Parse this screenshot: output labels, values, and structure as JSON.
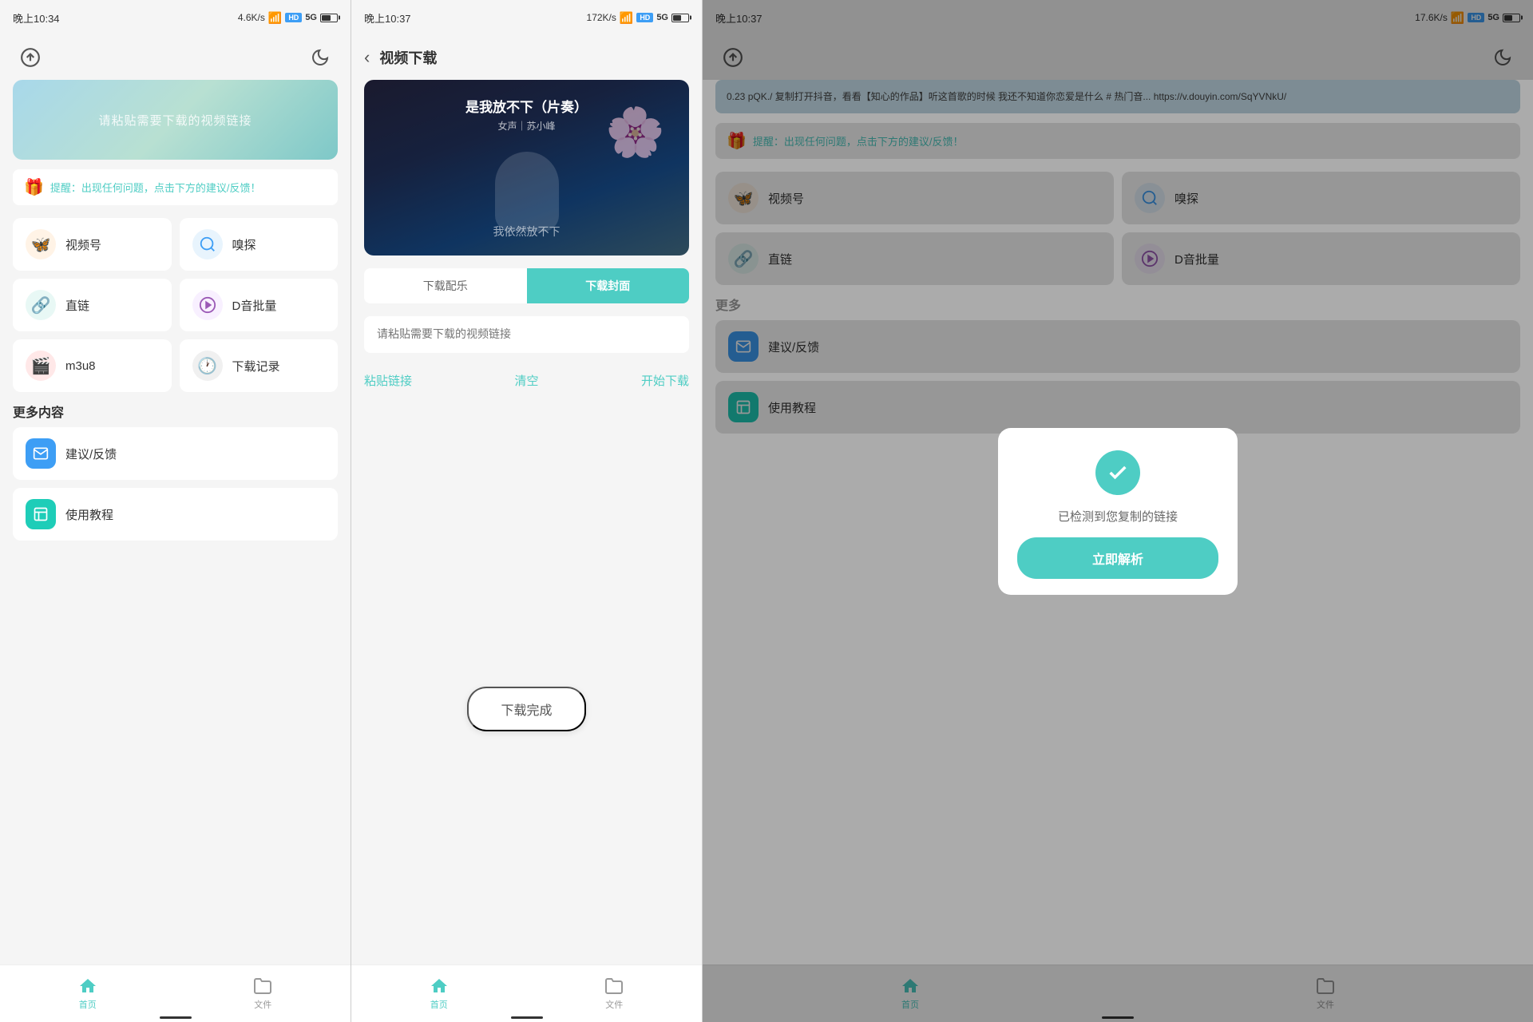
{
  "panel1": {
    "status": {
      "time": "晚上10:34",
      "speed": "4.6K/s",
      "hd": "HD",
      "signal": "5G",
      "battery": 60
    },
    "header": {
      "upload_icon": "☁",
      "moon_icon": "☾"
    },
    "hero": {
      "text": "请粘贴需要下载的视频链接"
    },
    "notice": {
      "icon": "🎁",
      "text": "提醒：出现任何问题，点击下方的建议/反馈！"
    },
    "grid_items": [
      {
        "id": "weishi",
        "icon": "🦋",
        "label": "视频号",
        "iconClass": "icon-weishi"
      },
      {
        "id": "miaopai",
        "icon": "🔍",
        "label": "嗅探",
        "iconClass": "icon-miaopai"
      },
      {
        "id": "zhilian",
        "icon": "🔗",
        "label": "直链",
        "iconClass": "icon-zhilian"
      },
      {
        "id": "dayin",
        "icon": "🎵",
        "label": "D音批量",
        "iconClass": "icon-dayin"
      },
      {
        "id": "m3u8",
        "icon": "🎬",
        "label": "m3u8",
        "iconClass": "icon-m3u8"
      },
      {
        "id": "record",
        "icon": "🕐",
        "label": "下载记录",
        "iconClass": "icon-record"
      }
    ],
    "more_section": "更多内容",
    "list_items": [
      {
        "id": "feedback",
        "icon": "✉",
        "label": "建议/反馈",
        "iconClass": "icon-feedback"
      },
      {
        "id": "tutorial",
        "icon": "📋",
        "label": "使用教程",
        "iconClass": "icon-tutorial"
      }
    ],
    "nav": {
      "home_label": "首页",
      "files_label": "文件"
    }
  },
  "panel2": {
    "status": {
      "time": "晚上10:37",
      "speed": "172K/s",
      "hd": "HD",
      "signal": "5G",
      "battery": 55
    },
    "header": {
      "back": "‹",
      "title": "视频下载"
    },
    "video": {
      "song_title": "是我放不下（片奏）",
      "singer": "女声｜苏小峰",
      "subtitle": "我依然放不下"
    },
    "tabs": [
      {
        "id": "music",
        "label": "下载配乐",
        "active": false
      },
      {
        "id": "cover",
        "label": "下载封面",
        "active": true
      }
    ],
    "input": {
      "placeholder": "请粘贴需要下载的视频链接"
    },
    "actions": {
      "paste": "粘贴链接",
      "clear": "清空",
      "start": "开始下载"
    },
    "download_complete": "下载完成",
    "nav": {
      "home_label": "首页",
      "files_label": "文件"
    }
  },
  "panel3": {
    "status": {
      "time": "晚上10:37",
      "speed": "17.6K/s",
      "hd": "HD",
      "signal": "5G",
      "battery": 55
    },
    "clipboard_text": "0.23 pQK./ 复制打开抖音，看看【知心的作品】听这首歌的时候 我还不知道你恋爱是什么 # 热门音... https://v.douyin.com/SqYVNkU/",
    "notice": {
      "icon": "🎁",
      "text": "提醒：出现任何问题，点击下方的建议/反馈！"
    },
    "grid_items": [
      {
        "id": "weishi",
        "icon": "🦋",
        "label": "视频号",
        "iconClass": "icon-weishi"
      },
      {
        "id": "miaopai",
        "icon": "🔍",
        "label": "嗅探",
        "iconClass": "icon-miaopai"
      },
      {
        "id": "zhilian",
        "icon": "🔗",
        "label": "直链",
        "iconClass": "icon-zhilian"
      },
      {
        "id": "dayin",
        "icon": "🎵",
        "label": "D音批量",
        "iconClass": "icon-dayin"
      }
    ],
    "dialog": {
      "check_icon": "✓",
      "message": "已检测到您复制的链接",
      "confirm_label": "立即解析"
    },
    "more_label": "更多",
    "list_items": [
      {
        "id": "feedback",
        "icon": "✉",
        "label": "建议/反馈",
        "iconClass": "icon-feedback"
      },
      {
        "id": "tutorial",
        "icon": "📋",
        "label": "使用教程",
        "iconClass": "icon-tutorial"
      }
    ],
    "nav": {
      "home_label": "首页",
      "files_label": "文件"
    }
  }
}
